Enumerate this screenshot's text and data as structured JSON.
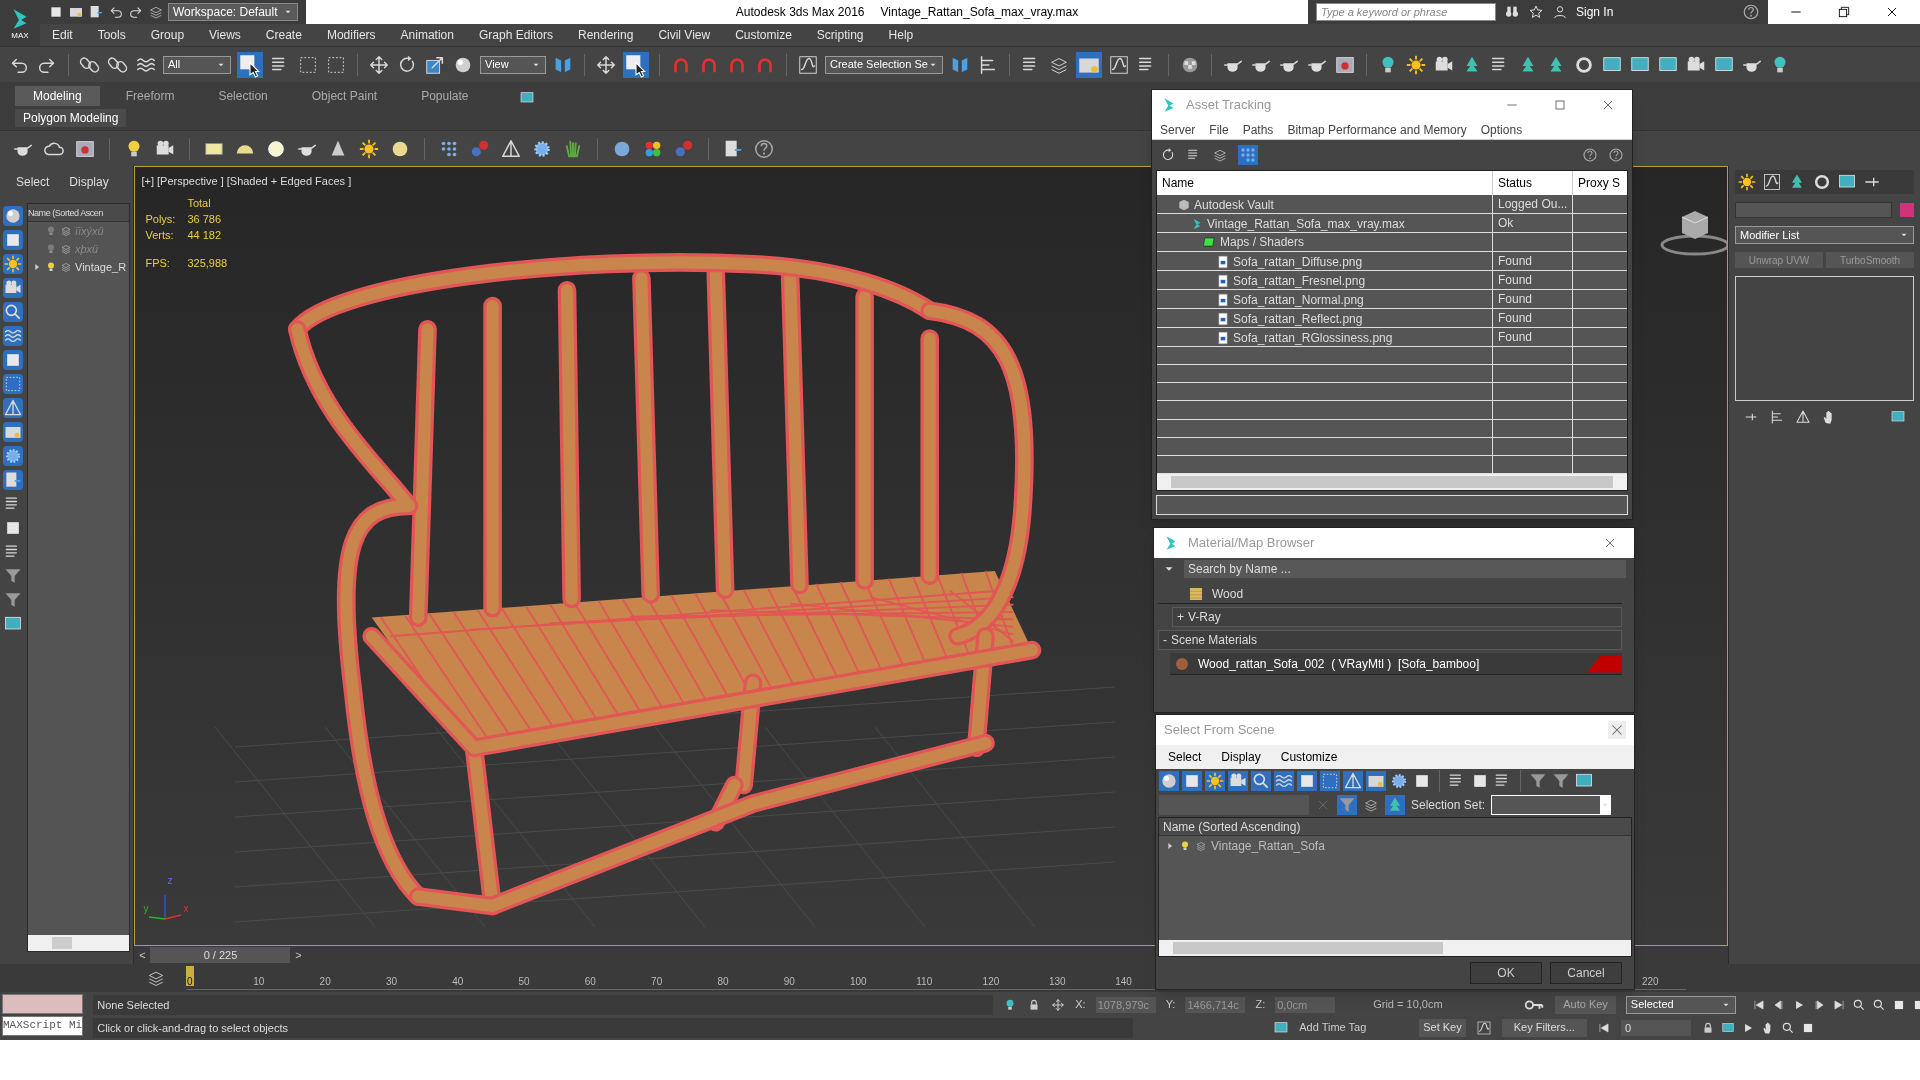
{
  "app": {
    "logo": "MAX",
    "workspace": "Workspace: Default",
    "title": "Autodesk 3ds Max 2016",
    "file": "Vintage_Rattan_Sofa_max_vray.max",
    "search": {
      "placeholder": "Type a keyword or phrase"
    },
    "sign_in": "Sign In"
  },
  "menu": [
    "Edit",
    "Tools",
    "Group",
    "Views",
    "Create",
    "Modifiers",
    "Animation",
    "Graph Editors",
    "Rendering",
    "Civil View",
    "Customize",
    "Scripting",
    "Help"
  ],
  "toolbar": {
    "dropdowns": [
      "All",
      "View",
      "Create Selection Se"
    ]
  },
  "ribbon": {
    "tabs": [
      {
        "label": "Modeling",
        "selected": true
      },
      {
        "label": "Freeform",
        "selected": false
      },
      {
        "label": "Selection",
        "selected": false
      },
      {
        "label": "Object Paint",
        "selected": false
      },
      {
        "label": "Populate",
        "selected": false
      }
    ],
    "panel": "Polygon Modeling"
  },
  "scene_explorer": {
    "tabs": [
      "Select",
      "Display"
    ],
    "header": "Name (Sorted Ascen",
    "items": [
      {
        "name": "ïïxýxû",
        "hidden": true,
        "expanded": false
      },
      {
        "name": "xþxü",
        "hidden": true,
        "expanded": false
      },
      {
        "name": "Vintage_R",
        "hidden": false,
        "expanded": false
      }
    ]
  },
  "viewport": {
    "label": "[+] [Perspective ] [Shaded + Edged Faces ]",
    "stats": {
      "heading": "Total",
      "rows": [
        {
          "label": "Polys:",
          "value": "36 786"
        },
        {
          "label": "Verts:",
          "value": "44 182"
        }
      ],
      "fps_label": "FPS:",
      "fps": "325,988"
    },
    "axes": [
      "z",
      "y",
      "x"
    ],
    "frame": {
      "prev": "<",
      "position": "0 / 225",
      "next": ">"
    }
  },
  "command_panel": {
    "modifier_list": "Modifier List",
    "modifiers": [
      "Unwrap UVW",
      "TurboSmooth"
    ],
    "color": "#d0327a"
  },
  "asset_tracking": {
    "title": "Asset Tracking",
    "menu": [
      "Server",
      "File",
      "Paths",
      "Bitmap Performance and Memory",
      "Options"
    ],
    "columns": [
      "Name",
      "Status",
      "Proxy S"
    ],
    "tree": [
      {
        "kind": "vault",
        "name": "Autodesk Vault",
        "status": "Logged Ou...",
        "children": [
          {
            "kind": "scene",
            "name": "Vintage_Rattan_Sofa_max_vray.max",
            "status": "Ok",
            "children": [
              {
                "kind": "maps",
                "name": "Maps / Shaders",
                "children": [
                  {
                    "kind": "bitmap",
                    "name": "Sofa_rattan_Diffuse.png",
                    "status": "Found"
                  },
                  {
                    "kind": "bitmap",
                    "name": "Sofa_rattan_Fresnel.png",
                    "status": "Found"
                  },
                  {
                    "kind": "bitmap",
                    "name": "Sofa_rattan_Normal.png",
                    "status": "Found"
                  },
                  {
                    "kind": "bitmap",
                    "name": "Sofa_rattan_Reflect.png",
                    "status": "Found"
                  },
                  {
                    "kind": "bitmap",
                    "name": "Sofa_rattan_RGlossiness.png",
                    "status": "Found"
                  }
                ]
              }
            ]
          }
        ]
      }
    ]
  },
  "material_browser": {
    "title": "Material/Map Browser",
    "search": {
      "placeholder": "Search by Name ..."
    },
    "top_item": "Wood",
    "groups": [
      {
        "sign": "+",
        "label": "V-Ray",
        "expanded": false
      },
      {
        "sign": "-",
        "label": "Scene Materials",
        "expanded": true,
        "items": [
          "Wood_rattan_Sofa_002  ( VRayMtl )  [Sofa_bamboo]"
        ]
      }
    ]
  },
  "select_from_scene": {
    "title": "Select From Scene",
    "menu": [
      "Select",
      "Display",
      "Customize"
    ],
    "selection_set": "Selection Set:",
    "header": "Name (Sorted Ascending)",
    "items": [
      {
        "name": "Vintage_Rattan_Sofa",
        "expanded": false
      }
    ],
    "buttons": [
      "OK",
      "Cancel"
    ]
  },
  "timeline": {
    "ticks": [
      "0",
      "10",
      "20",
      "30",
      "40",
      "50",
      "60",
      "70",
      "80",
      "90",
      "100",
      "110",
      "120",
      "130",
      "140"
    ],
    "end_tick": "220"
  },
  "status": {
    "maxscript": "MAXScript Mi",
    "selection": "None Selected",
    "prompt": "Click or click-and-drag to select objects",
    "x_label": "X:",
    "x": "1078,979c",
    "y_label": "Y:",
    "y": "1466,714c",
    "z_label": "Z:",
    "z": "0,0cm",
    "grid": "Grid = 10,0cm",
    "add_time_tag": "Add Time Tag",
    "auto_key": "Auto Key",
    "key_mode": "Selected",
    "set_key": "Set Key",
    "key_filters": "Key Filters...",
    "frame": "0"
  }
}
